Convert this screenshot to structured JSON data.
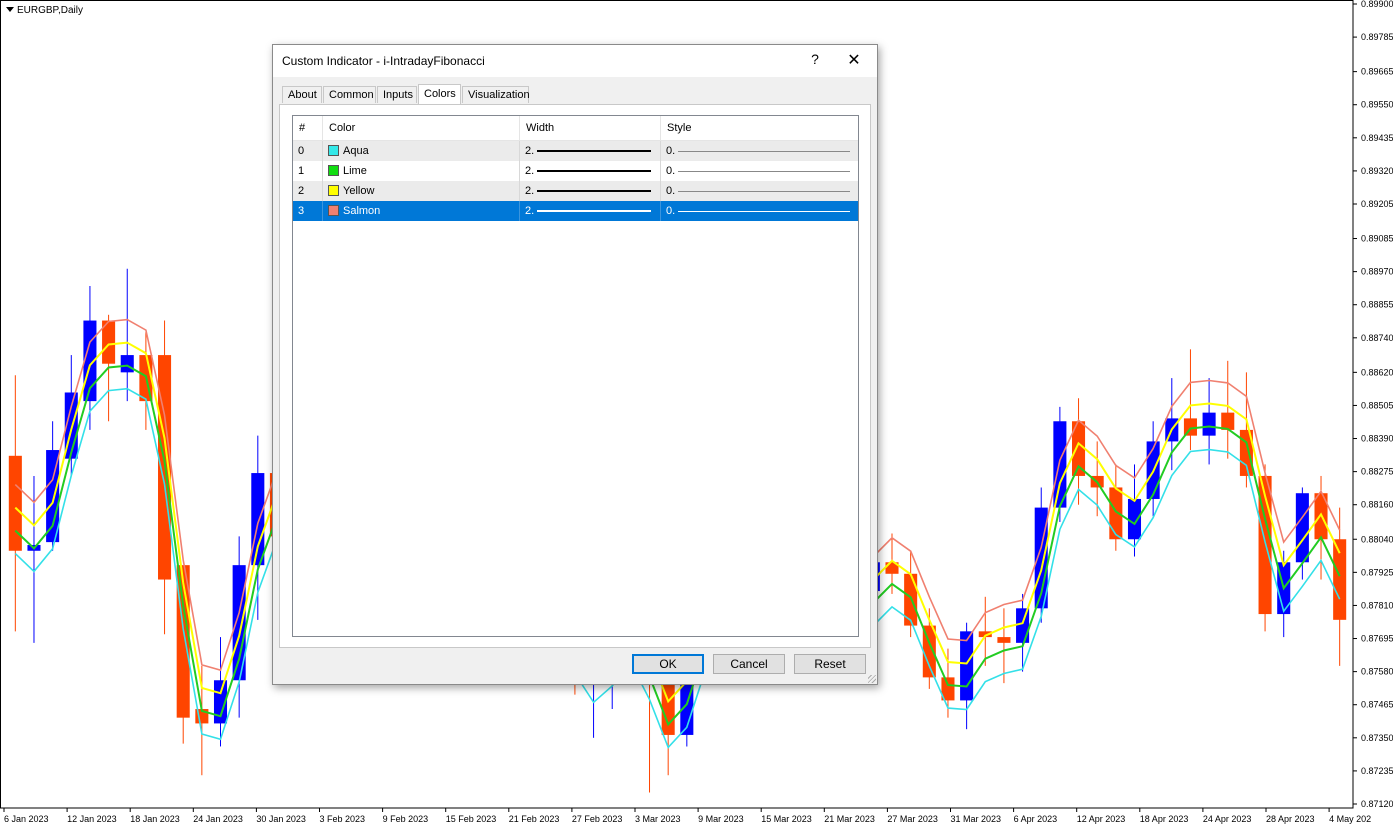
{
  "chart": {
    "symbol": "EURGBP,Daily",
    "price_labels": [
      "0.89900",
      "0.89785",
      "0.89665",
      "0.89550",
      "0.89435",
      "0.89320",
      "0.89205",
      "0.89085",
      "0.88970",
      "0.88855",
      "0.88740",
      "0.88620",
      "0.88505",
      "0.88390",
      "0.88275",
      "0.88160",
      "0.88040",
      "0.87925",
      "0.87810",
      "0.87695",
      "0.87580",
      "0.87465",
      "0.87350",
      "0.87235",
      "0.87120"
    ],
    "date_labels": [
      "6 Jan 2023",
      "12 Jan 2023",
      "18 Jan 2023",
      "24 Jan 2023",
      "30 Jan 2023",
      "3 Feb 2023",
      "9 Feb 2023",
      "15 Feb 2023",
      "21 Feb 2023",
      "27 Feb 2023",
      "3 Mar 2023",
      "9 Mar 2023",
      "15 Mar 2023",
      "21 Mar 2023",
      "27 Mar 2023",
      "31 Mar 2023",
      "6 Apr 2023",
      "12 Apr 2023",
      "18 Apr 2023",
      "24 Apr 2023",
      "28 Apr 2023",
      "4 May 202"
    ],
    "colors": {
      "bull": "#0000ff",
      "bear": "#ff4500",
      "aqua": "#33e0e8",
      "lime": "#22cc22",
      "yellow": "#ffff00",
      "salmon": "#f08070"
    }
  },
  "chart_data": {
    "type": "candlestick",
    "symbol": "EURGBP,Daily",
    "ylim": [
      0.8712,
      0.899
    ],
    "candles": [
      [
        0.8833,
        0.8861,
        0.8772,
        0.88
      ],
      [
        0.88,
        0.8826,
        0.8768,
        0.8802
      ],
      [
        0.8803,
        0.8845,
        0.88,
        0.8835
      ],
      [
        0.8832,
        0.8868,
        0.8826,
        0.8855
      ],
      [
        0.8852,
        0.8892,
        0.8842,
        0.888
      ],
      [
        0.888,
        0.8882,
        0.8845,
        0.8865
      ],
      [
        0.8862,
        0.8898,
        0.8852,
        0.8868
      ],
      [
        0.8868,
        0.8876,
        0.8842,
        0.8852
      ],
      [
        0.8868,
        0.888,
        0.8771,
        0.879
      ],
      [
        0.8795,
        0.8793,
        0.8733,
        0.8742
      ],
      [
        0.8745,
        0.876,
        0.8722,
        0.874
      ],
      [
        0.874,
        0.877,
        0.8732,
        0.8755
      ],
      [
        0.8755,
        0.8805,
        0.8742,
        0.8795
      ],
      [
        0.8795,
        0.884,
        0.8776,
        0.8827
      ],
      [
        0.8827,
        0.885,
        0.8795,
        0.8805
      ],
      [
        0.8805,
        0.8812,
        0.878,
        0.8782
      ],
      [
        0.8782,
        0.8795,
        0.8765,
        0.8768
      ],
      [
        0.8768,
        0.878,
        0.876,
        0.878
      ],
      [
        0.878,
        0.8815,
        0.877,
        0.8802
      ],
      [
        0.8805,
        0.883,
        0.879,
        0.8818
      ],
      [
        0.8818,
        0.8822,
        0.8792,
        0.88
      ],
      [
        0.88,
        0.8812,
        0.878,
        0.8788
      ],
      [
        0.8788,
        0.8805,
        0.8778,
        0.8786
      ],
      [
        0.8786,
        0.8808,
        0.878,
        0.88
      ],
      [
        0.88,
        0.8826,
        0.879,
        0.8818
      ],
      [
        0.8818,
        0.883,
        0.8798,
        0.8802
      ],
      [
        0.8802,
        0.8816,
        0.877,
        0.8798
      ],
      [
        0.8798,
        0.8808,
        0.8784,
        0.8784
      ],
      [
        0.8784,
        0.8798,
        0.8766,
        0.8792
      ],
      [
        0.8792,
        0.88,
        0.8764,
        0.8766
      ],
      [
        0.8766,
        0.878,
        0.875,
        0.8756
      ],
      [
        0.8756,
        0.877,
        0.8735,
        0.8765
      ],
      [
        0.8765,
        0.879,
        0.8745,
        0.8785
      ],
      [
        0.8785,
        0.8796,
        0.876,
        0.8762
      ],
      [
        0.8762,
        0.877,
        0.8716,
        0.8758
      ],
      [
        0.8758,
        0.876,
        0.8722,
        0.8736
      ],
      [
        0.8736,
        0.878,
        0.8732,
        0.8774
      ],
      [
        0.8774,
        0.879,
        0.876,
        0.8788
      ],
      [
        0.8788,
        0.8808,
        0.8778,
        0.8804
      ],
      [
        0.8804,
        0.884,
        0.8797,
        0.8816
      ],
      [
        0.8816,
        0.8832,
        0.8784,
        0.8794
      ],
      [
        0.8794,
        0.8822,
        0.8782,
        0.8786
      ],
      [
        0.8786,
        0.8808,
        0.8776,
        0.8798
      ],
      [
        0.8798,
        0.8812,
        0.8778,
        0.8782
      ],
      [
        0.8782,
        0.8796,
        0.877,
        0.8776
      ],
      [
        0.8776,
        0.879,
        0.8768,
        0.8786
      ],
      [
        0.8786,
        0.88,
        0.8776,
        0.8796
      ],
      [
        0.8796,
        0.8806,
        0.8785,
        0.8792
      ],
      [
        0.8792,
        0.88,
        0.877,
        0.8774
      ],
      [
        0.8774,
        0.878,
        0.8752,
        0.8756
      ],
      [
        0.8756,
        0.8766,
        0.8742,
        0.8748
      ],
      [
        0.8748,
        0.8775,
        0.8738,
        0.8772
      ],
      [
        0.8772,
        0.8784,
        0.876,
        0.877
      ],
      [
        0.877,
        0.878,
        0.8754,
        0.8768
      ],
      [
        0.8768,
        0.8785,
        0.8758,
        0.878
      ],
      [
        0.878,
        0.8822,
        0.8775,
        0.8815
      ],
      [
        0.8815,
        0.885,
        0.881,
        0.8845
      ],
      [
        0.8845,
        0.8853,
        0.8816,
        0.8826
      ],
      [
        0.8826,
        0.8838,
        0.8812,
        0.8822
      ],
      [
        0.8822,
        0.883,
        0.88,
        0.8804
      ],
      [
        0.8804,
        0.883,
        0.8798,
        0.8818
      ],
      [
        0.8818,
        0.8845,
        0.8812,
        0.8838
      ],
      [
        0.8838,
        0.886,
        0.8828,
        0.8846
      ],
      [
        0.8846,
        0.887,
        0.8835,
        0.884
      ],
      [
        0.884,
        0.886,
        0.883,
        0.8848
      ],
      [
        0.8848,
        0.8866,
        0.8832,
        0.8842
      ],
      [
        0.8842,
        0.8862,
        0.8822,
        0.8826
      ],
      [
        0.8826,
        0.883,
        0.8772,
        0.8778
      ],
      [
        0.8778,
        0.88,
        0.877,
        0.8796
      ],
      [
        0.8796,
        0.8822,
        0.879,
        0.882
      ],
      [
        0.882,
        0.8826,
        0.879,
        0.8804
      ],
      [
        0.8804,
        0.8815,
        0.876,
        0.8776
      ]
    ],
    "lines": [
      {
        "name": "Aqua",
        "color": "#33e0e8"
      },
      {
        "name": "Lime",
        "color": "#22cc22"
      },
      {
        "name": "Yellow",
        "color": "#ffff00"
      },
      {
        "name": "Salmon",
        "color": "#f08070"
      }
    ]
  },
  "dialog": {
    "title": "Custom Indicator - i-IntradayFibonacci",
    "help": "?",
    "close": "✕",
    "tabs": [
      {
        "label": "About"
      },
      {
        "label": "Common"
      },
      {
        "label": "Inputs"
      },
      {
        "label": "Colors",
        "active": true
      },
      {
        "label": "Visualization"
      }
    ],
    "columns": {
      "num": "#",
      "color": "Color",
      "width": "Width",
      "style": "Style"
    },
    "rows": [
      {
        "num": "0",
        "color": "Aqua",
        "swatch": "#33e8e8",
        "width": "2.",
        "style": "0."
      },
      {
        "num": "1",
        "color": "Lime",
        "swatch": "#11dd11",
        "width": "2.",
        "style": "0."
      },
      {
        "num": "2",
        "color": "Yellow",
        "swatch": "#ffff00",
        "width": "2.",
        "style": "0."
      },
      {
        "num": "3",
        "color": "Salmon",
        "swatch": "#f08070",
        "width": "2.",
        "style": "0.",
        "selected": true
      }
    ],
    "buttons": {
      "ok": "OK",
      "cancel": "Cancel",
      "reset": "Reset"
    }
  }
}
